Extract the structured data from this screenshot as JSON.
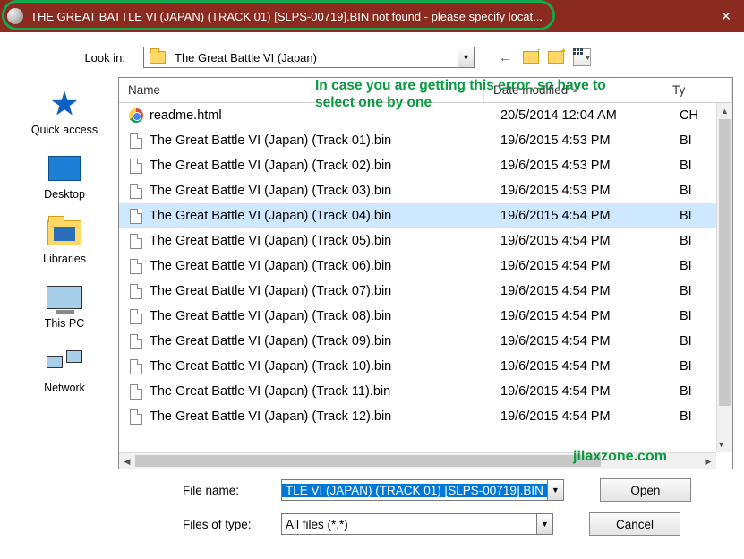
{
  "title": "THE GREAT BATTLE VI (JAPAN) (TRACK 01) [SLPS-00719].BIN not found - please specify locat...",
  "lookin": {
    "label": "Look in:",
    "value": "The Great Battle VI (Japan)"
  },
  "columns": {
    "name": "Name",
    "date": "Date modified",
    "type": "Ty"
  },
  "places": {
    "quick": "Quick access",
    "desktop": "Desktop",
    "libraries": "Libraries",
    "thispc": "This PC",
    "network": "Network"
  },
  "files": [
    {
      "icon": "chrome",
      "name": "readme.html",
      "date": "20/5/2014 12:04 AM",
      "type": "CH",
      "sel": false
    },
    {
      "icon": "doc",
      "name": "The Great Battle VI (Japan) (Track 01).bin",
      "date": "19/6/2015 4:53 PM",
      "type": "BI",
      "sel": false
    },
    {
      "icon": "doc",
      "name": "The Great Battle VI (Japan) (Track 02).bin",
      "date": "19/6/2015 4:53 PM",
      "type": "BI",
      "sel": false
    },
    {
      "icon": "doc",
      "name": "The Great Battle VI (Japan) (Track 03).bin",
      "date": "19/6/2015 4:53 PM",
      "type": "BI",
      "sel": false
    },
    {
      "icon": "doc",
      "name": "The Great Battle VI (Japan) (Track 04).bin",
      "date": "19/6/2015 4:54 PM",
      "type": "BI",
      "sel": true
    },
    {
      "icon": "doc",
      "name": "The Great Battle VI (Japan) (Track 05).bin",
      "date": "19/6/2015 4:54 PM",
      "type": "BI",
      "sel": false
    },
    {
      "icon": "doc",
      "name": "The Great Battle VI (Japan) (Track 06).bin",
      "date": "19/6/2015 4:54 PM",
      "type": "BI",
      "sel": false
    },
    {
      "icon": "doc",
      "name": "The Great Battle VI (Japan) (Track 07).bin",
      "date": "19/6/2015 4:54 PM",
      "type": "BI",
      "sel": false
    },
    {
      "icon": "doc",
      "name": "The Great Battle VI (Japan) (Track 08).bin",
      "date": "19/6/2015 4:54 PM",
      "type": "BI",
      "sel": false
    },
    {
      "icon": "doc",
      "name": "The Great Battle VI (Japan) (Track 09).bin",
      "date": "19/6/2015 4:54 PM",
      "type": "BI",
      "sel": false
    },
    {
      "icon": "doc",
      "name": "The Great Battle VI (Japan) (Track 10).bin",
      "date": "19/6/2015 4:54 PM",
      "type": "BI",
      "sel": false
    },
    {
      "icon": "doc",
      "name": "The Great Battle VI (Japan) (Track 11).bin",
      "date": "19/6/2015 4:54 PM",
      "type": "BI",
      "sel": false
    },
    {
      "icon": "doc",
      "name": "The Great Battle VI (Japan) (Track 12).bin",
      "date": "19/6/2015 4:54 PM",
      "type": "BI",
      "sel": false
    }
  ],
  "filename": {
    "label": "File name:",
    "value": "TLE VI (JAPAN) (TRACK 01) [SLPS-00719].BIN"
  },
  "filetype": {
    "label": "Files of type:",
    "value": "All files (*.*)"
  },
  "buttons": {
    "open": "Open",
    "cancel": "Cancel"
  },
  "annotations": {
    "hint": "In case you are getting this error, so have to select one by one",
    "watermark": "jilaxzone.com"
  }
}
